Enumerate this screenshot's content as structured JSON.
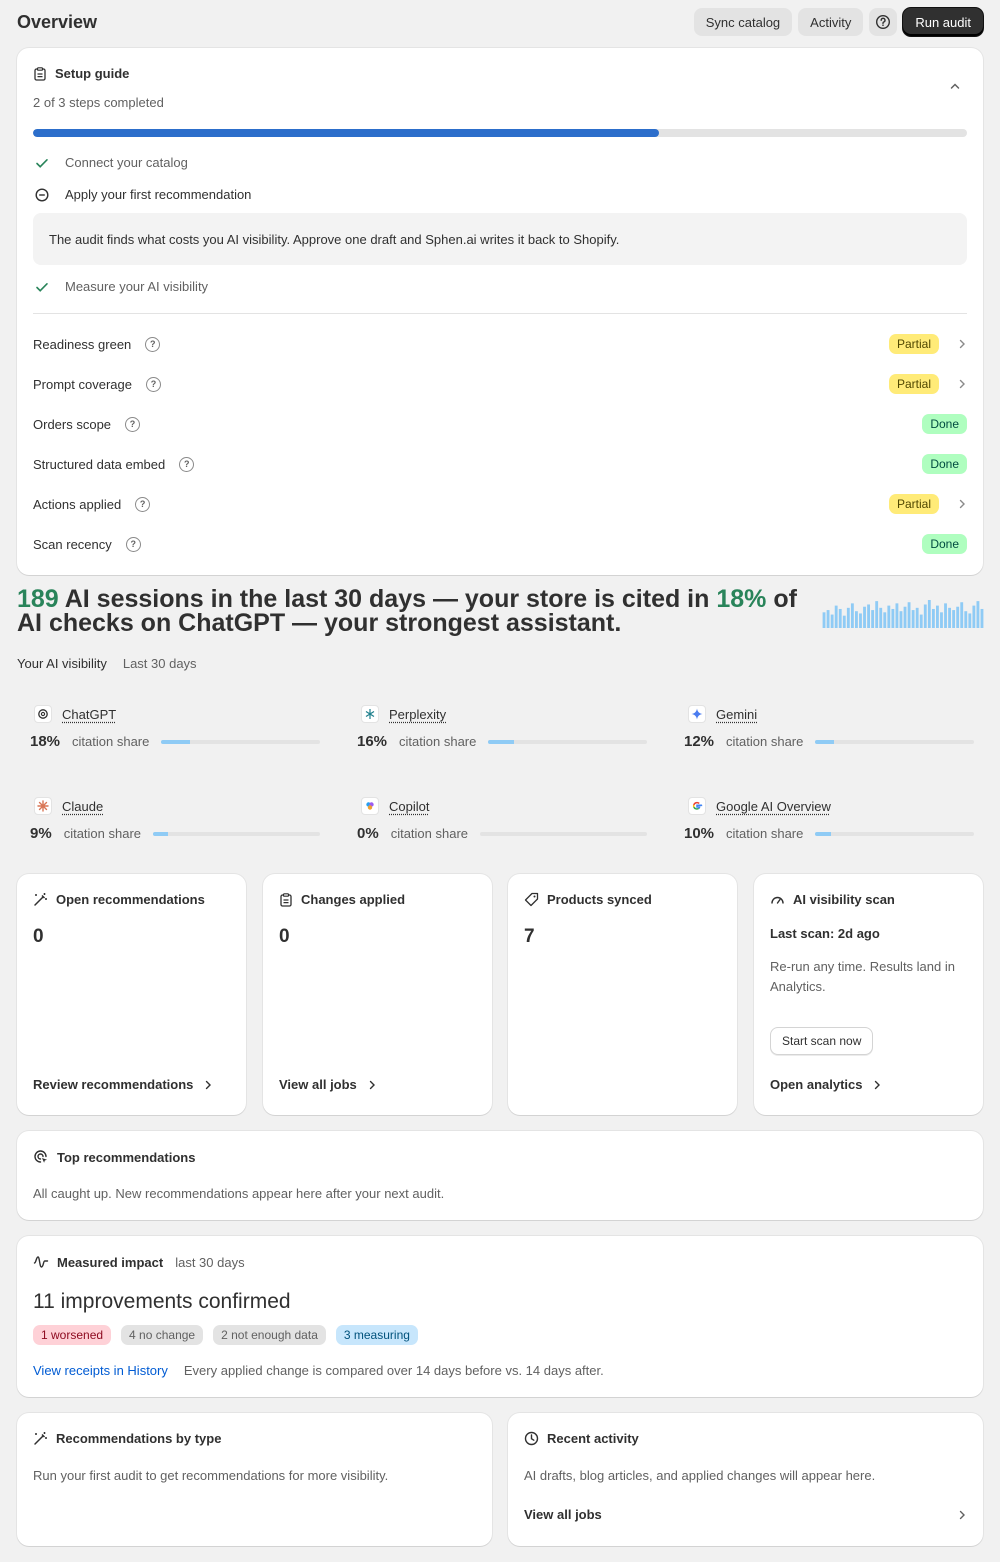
{
  "header": {
    "title": "Overview",
    "sync_label": "Sync catalog",
    "activity_label": "Activity",
    "run_audit_label": "Run audit"
  },
  "setup": {
    "title": "Setup guide",
    "subtitle": "2 of 3 steps completed",
    "progress": 0.67,
    "steps": [
      {
        "label": "Connect your catalog",
        "state": "done"
      },
      {
        "label": "Apply your first recommendation",
        "state": "active"
      },
      {
        "label": "Measure your AI visibility",
        "state": "done"
      }
    ],
    "active_note": "The audit finds what costs you AI visibility. Approve one draft and Sphen.ai writes it back to Shopify.",
    "checks": [
      {
        "label": "Readiness green",
        "status": "Partial"
      },
      {
        "label": "Prompt coverage",
        "status": "Partial"
      },
      {
        "label": "Orders scope",
        "status": "Done"
      },
      {
        "label": "Structured data embed",
        "status": "Done"
      },
      {
        "label": "Actions applied",
        "status": "Partial"
      },
      {
        "label": "Scan recency",
        "status": "Done"
      }
    ]
  },
  "headline": {
    "sessions": "189",
    "part1": " AI sessions in the last 30 days — your store is cited in ",
    "share": "18%",
    "part2": " of AI checks on ChatGPT — your strongest assistant."
  },
  "sparkline": [
    14,
    16,
    12,
    20,
    17,
    11,
    18,
    22,
    15,
    13,
    19,
    21,
    16,
    24,
    18,
    14,
    20,
    17,
    22,
    15,
    19,
    23,
    16,
    18,
    12,
    21,
    25,
    17,
    20,
    14,
    22,
    18,
    16,
    19,
    23,
    15,
    13,
    20,
    24,
    17
  ],
  "visibility": {
    "title": "Your AI visibility",
    "period": "Last 30 days",
    "assistants": [
      {
        "name": "ChatGPT",
        "pct": "18%",
        "label": "citation share",
        "share": 0.18,
        "icon": "chatgpt-icon"
      },
      {
        "name": "Perplexity",
        "pct": "16%",
        "label": "citation share",
        "share": 0.16,
        "icon": "perplexity-icon"
      },
      {
        "name": "Gemini",
        "pct": "12%",
        "label": "citation share",
        "share": 0.12,
        "icon": "gemini-icon"
      },
      {
        "name": "Claude",
        "pct": "9%",
        "label": "citation share",
        "share": 0.09,
        "icon": "claude-icon"
      },
      {
        "name": "Copilot",
        "pct": "0%",
        "label": "citation share",
        "share": 0.0,
        "icon": "copilot-icon"
      },
      {
        "name": "Google AI Overview",
        "pct": "10%",
        "label": "citation share",
        "share": 0.1,
        "icon": "google-icon"
      }
    ]
  },
  "stats": {
    "open_recs": {
      "title": "Open recommendations",
      "value": "0",
      "link": "Review recommendations"
    },
    "changes": {
      "title": "Changes applied",
      "value": "0",
      "link": "View all jobs"
    },
    "products": {
      "title": "Products synced",
      "value": "7"
    },
    "scan": {
      "title": "AI visibility scan",
      "last": "Last scan: 2d ago",
      "desc": "Re-run any time. Results land in Analytics.",
      "button": "Start scan now",
      "link": "Open analytics"
    }
  },
  "top_recs": {
    "title": "Top recommendations",
    "text": "All caught up. New recommendations appear here after your next audit."
  },
  "impact": {
    "title": "Measured impact",
    "period": "last 30 days",
    "headline": "11 improvements confirmed",
    "chips": {
      "worsened": "1 worsened",
      "no_change": "4 no change",
      "not_enough": "2 not enough data",
      "measuring": "3 measuring"
    },
    "link": "View receipts in History",
    "note": "Every applied change is compared over 14 days before vs. 14 days after."
  },
  "recs_by_type": {
    "title": "Recommendations by type",
    "text": "Run your first audit to get recommendations for more visibility."
  },
  "recent": {
    "title": "Recent activity",
    "text": "AI drafts, blog articles, and applied changes will appear here.",
    "link": "View all jobs"
  },
  "colors": {
    "accent_green": "#29845a",
    "progress_blue": "#2c6ecb",
    "bar_blue": "#8fcbf5"
  }
}
